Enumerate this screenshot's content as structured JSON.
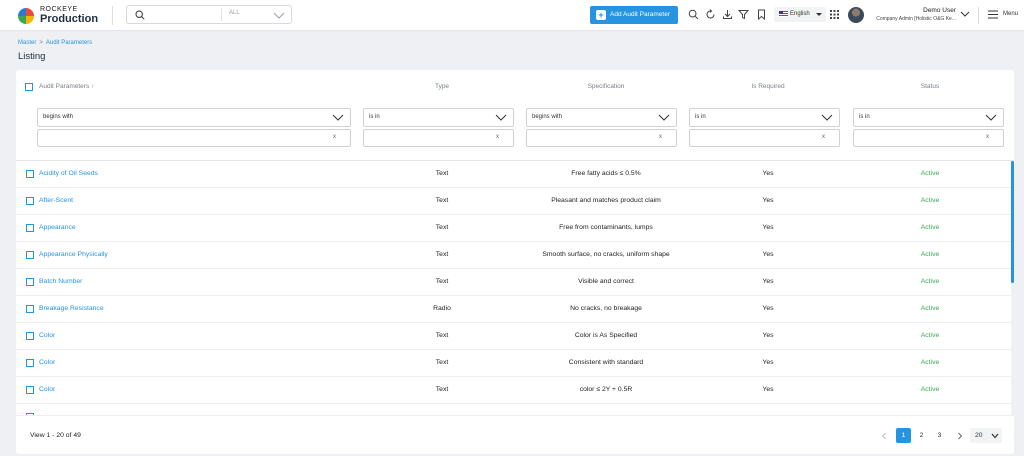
{
  "app": {
    "logo_top": "ROCKEYE",
    "logo_bottom": "Production"
  },
  "search": {
    "placeholder": "",
    "scope": "ALL"
  },
  "toolbar": {
    "add_label": "Add Audit Parameter",
    "language": "English",
    "icons": [
      "search-icon",
      "refresh-icon",
      "download-icon",
      "filter-icon",
      "bookmark-icon",
      "apps-grid-icon"
    ]
  },
  "user": {
    "name": "Demo User",
    "role": "Company Admin [Holistic O&G Ke..."
  },
  "menu": {
    "label": "Menu"
  },
  "breadcrumb": {
    "items": [
      "Master",
      "Audit Parameters"
    ]
  },
  "page": {
    "title": "Listing"
  },
  "table": {
    "columns": [
      "Audit Parameters",
      "Type",
      "Specification",
      "Is Required",
      "Status"
    ],
    "filters": [
      {
        "operator": "begins with",
        "value": ""
      },
      {
        "operator": "is in",
        "value": ""
      },
      {
        "operator": "begins with",
        "value": ""
      },
      {
        "operator": "is in",
        "value": ""
      },
      {
        "operator": "is in",
        "value": ""
      }
    ],
    "clear_symbol": "x",
    "rows": [
      {
        "name": "Acidity of Oil Seeds",
        "type": "Text",
        "spec": "Free fatty acids ≤ 0.5%",
        "required": "Yes",
        "status": "Active"
      },
      {
        "name": "After-Scent",
        "type": "Text",
        "spec": "Pleasant and matches product claim",
        "required": "Yes",
        "status": "Active"
      },
      {
        "name": "Appearance",
        "type": "Text",
        "spec": "Free from contaminants, lumps",
        "required": "Yes",
        "status": "Active"
      },
      {
        "name": "Appearance Physically",
        "type": "Text",
        "spec": "Smooth surface, no cracks, uniform shape",
        "required": "Yes",
        "status": "Active"
      },
      {
        "name": "Batch Number",
        "type": "Text",
        "spec": "Visible and correct",
        "required": "Yes",
        "status": "Active"
      },
      {
        "name": "Breakage Resistance",
        "type": "Radio",
        "spec": "No cracks, no breakage",
        "required": "Yes",
        "status": "Active"
      },
      {
        "name": "Color",
        "type": "Text",
        "spec": "Color is As Specified",
        "required": "Yes",
        "status": "Active"
      },
      {
        "name": "Color",
        "type": "Text",
        "spec": "Consistent with standard",
        "required": "Yes",
        "status": "Active"
      },
      {
        "name": "Color",
        "type": "Text",
        "spec": "color ≤ 2Y + 0.5R",
        "required": "Yes",
        "status": "Active"
      }
    ]
  },
  "footer": {
    "view_text": "View 1 - 20 of 49",
    "pages": [
      "1",
      "2",
      "3"
    ],
    "active_page": "1",
    "page_size": "20"
  },
  "colors": {
    "accent": "#2694e0",
    "status_active": "#3aa757"
  }
}
